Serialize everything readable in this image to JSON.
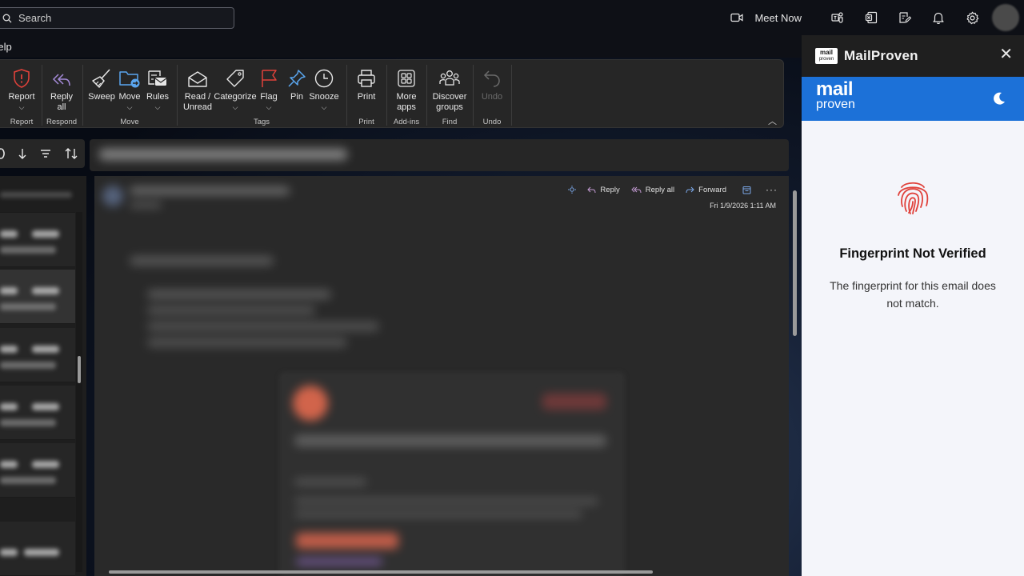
{
  "topbar": {
    "search_placeholder": "Search",
    "meet_now": "Meet Now"
  },
  "menu": {
    "help": "Help"
  },
  "ribbon": {
    "groups": [
      {
        "label": "Report",
        "buttons": [
          "Report"
        ]
      },
      {
        "label": "Respond",
        "buttons": [
          "Reply all"
        ]
      },
      {
        "label": "Move",
        "buttons": [
          "Sweep",
          "Move",
          "Rules"
        ]
      },
      {
        "label": "Tags",
        "buttons": [
          "Read / Unread",
          "Categorize",
          "Flag",
          "Pin",
          "Snooze"
        ]
      },
      {
        "label": "Print",
        "buttons": [
          "Print"
        ]
      },
      {
        "label": "Add-ins",
        "buttons": [
          "More apps"
        ]
      },
      {
        "label": "Find",
        "buttons": [
          "Discover groups"
        ]
      },
      {
        "label": "Undo",
        "buttons": [
          "Undo"
        ]
      }
    ],
    "report": "Report",
    "reply_all_1": "Reply",
    "reply_all_2": "all",
    "sweep": "Sweep",
    "move": "Move",
    "rules": "Rules",
    "read_1": "Read /",
    "read_2": "Unread",
    "categorize": "Categorize",
    "flag": "Flag",
    "pin": "Pin",
    "snooze": "Snooze",
    "print": "Print",
    "more_1": "More",
    "more_2": "apps",
    "discover_1": "Discover",
    "discover_2": "groups",
    "undo": "Undo",
    "label_report": "Report",
    "label_respond": "Respond",
    "label_move": "Move",
    "label_tags": "Tags",
    "label_print": "Print",
    "label_addins": "Add-ins",
    "label_find": "Find",
    "label_undo": "Undo"
  },
  "message": {
    "reply": "Reply",
    "reply_all": "Reply all",
    "forward": "Forward",
    "date": "Fri 1/9/2026 1:11 AM"
  },
  "side_panel": {
    "title": "MailProven",
    "logo_small_1": "mail",
    "logo_small_2": "proven",
    "banner_1": "mail",
    "banner_2": "proven",
    "status_title": "Fingerprint Not Verified",
    "status_desc": "The fingerprint for this email does not match."
  },
  "colors": {
    "accent_blue": "#1c71d8",
    "alert_red": "#e0413a",
    "panel_bg": "#f4f5fa"
  }
}
